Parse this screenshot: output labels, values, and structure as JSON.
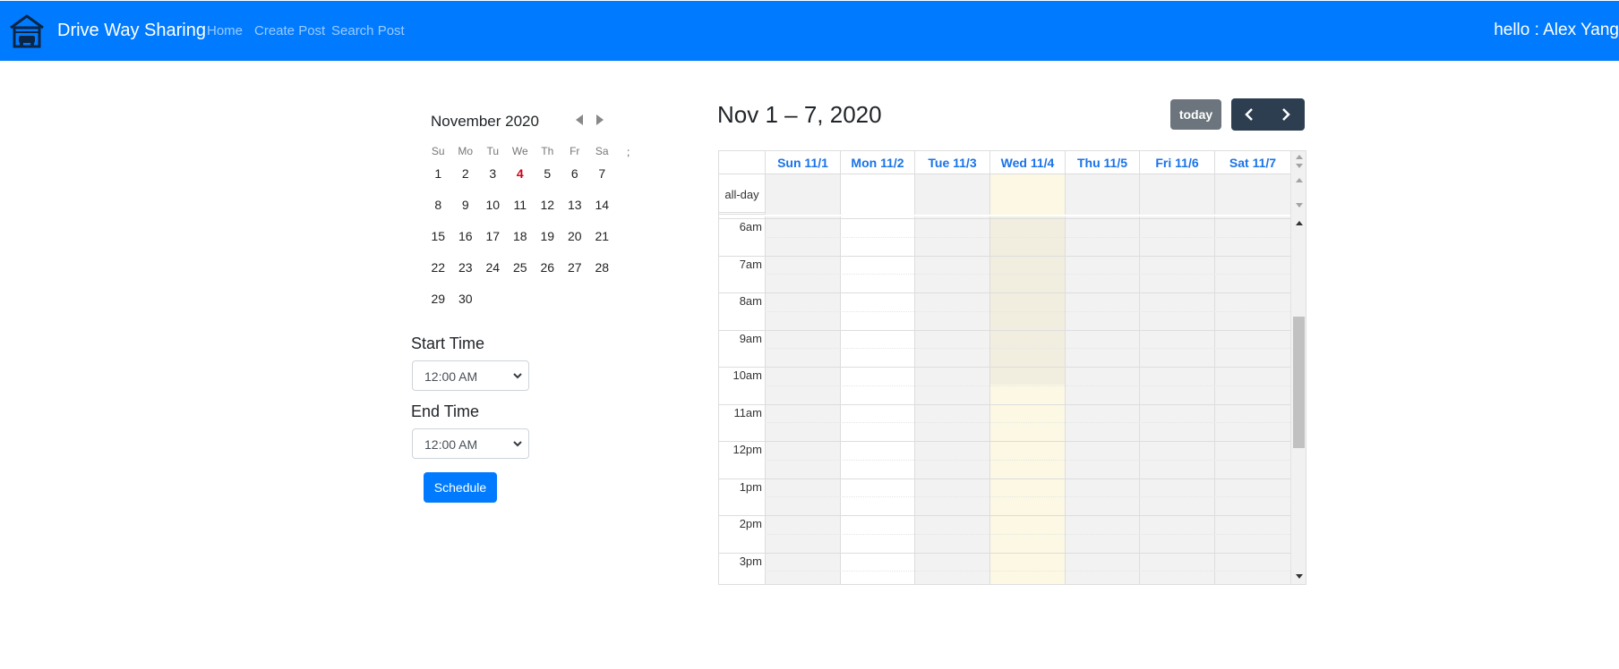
{
  "navbar": {
    "brand": "Drive Way Sharing",
    "logo_icon": "garage-car-icon",
    "links": [
      "Home",
      "Create Post",
      "Search Post"
    ],
    "user_greeting": "hello : Alex Yang",
    "background_color": "#007bff"
  },
  "mini_calendar": {
    "month_title": "November 2020",
    "weekdays": [
      "Su",
      "Mo",
      "Tu",
      "We",
      "Th",
      "Fr",
      "Sa"
    ],
    "extra_mark": ";",
    "weeks": [
      [
        "1",
        "2",
        "3",
        "4",
        "5",
        "6",
        "7"
      ],
      [
        "8",
        "9",
        "10",
        "11",
        "12",
        "13",
        "14"
      ],
      [
        "15",
        "16",
        "17",
        "18",
        "19",
        "20",
        "21"
      ],
      [
        "22",
        "23",
        "24",
        "25",
        "26",
        "27",
        "28"
      ],
      [
        "29",
        "30",
        "",
        "",
        "",
        "",
        ""
      ]
    ],
    "today": "4",
    "today_color": "#d0021b"
  },
  "form": {
    "start_label": "Start Time",
    "start_value": "12:00 AM",
    "end_label": "End Time",
    "end_value": "12:00 AM",
    "submit_label": "Schedule"
  },
  "calendar": {
    "title": "Nov 1 – 7, 2020",
    "today_button": "today",
    "days": [
      "Sun 11/1",
      "Mon 11/2",
      "Tue 11/3",
      "Wed 11/4",
      "Thu 11/5",
      "Fri 11/6",
      "Sat 11/7"
    ],
    "today_index": 3,
    "allday_label": "all-day",
    "hours": [
      "6am",
      "7am",
      "8am",
      "9am",
      "10am",
      "11am",
      "12pm",
      "1pm",
      "2pm",
      "3pm"
    ],
    "highlight_color": "#fcf8e3"
  }
}
